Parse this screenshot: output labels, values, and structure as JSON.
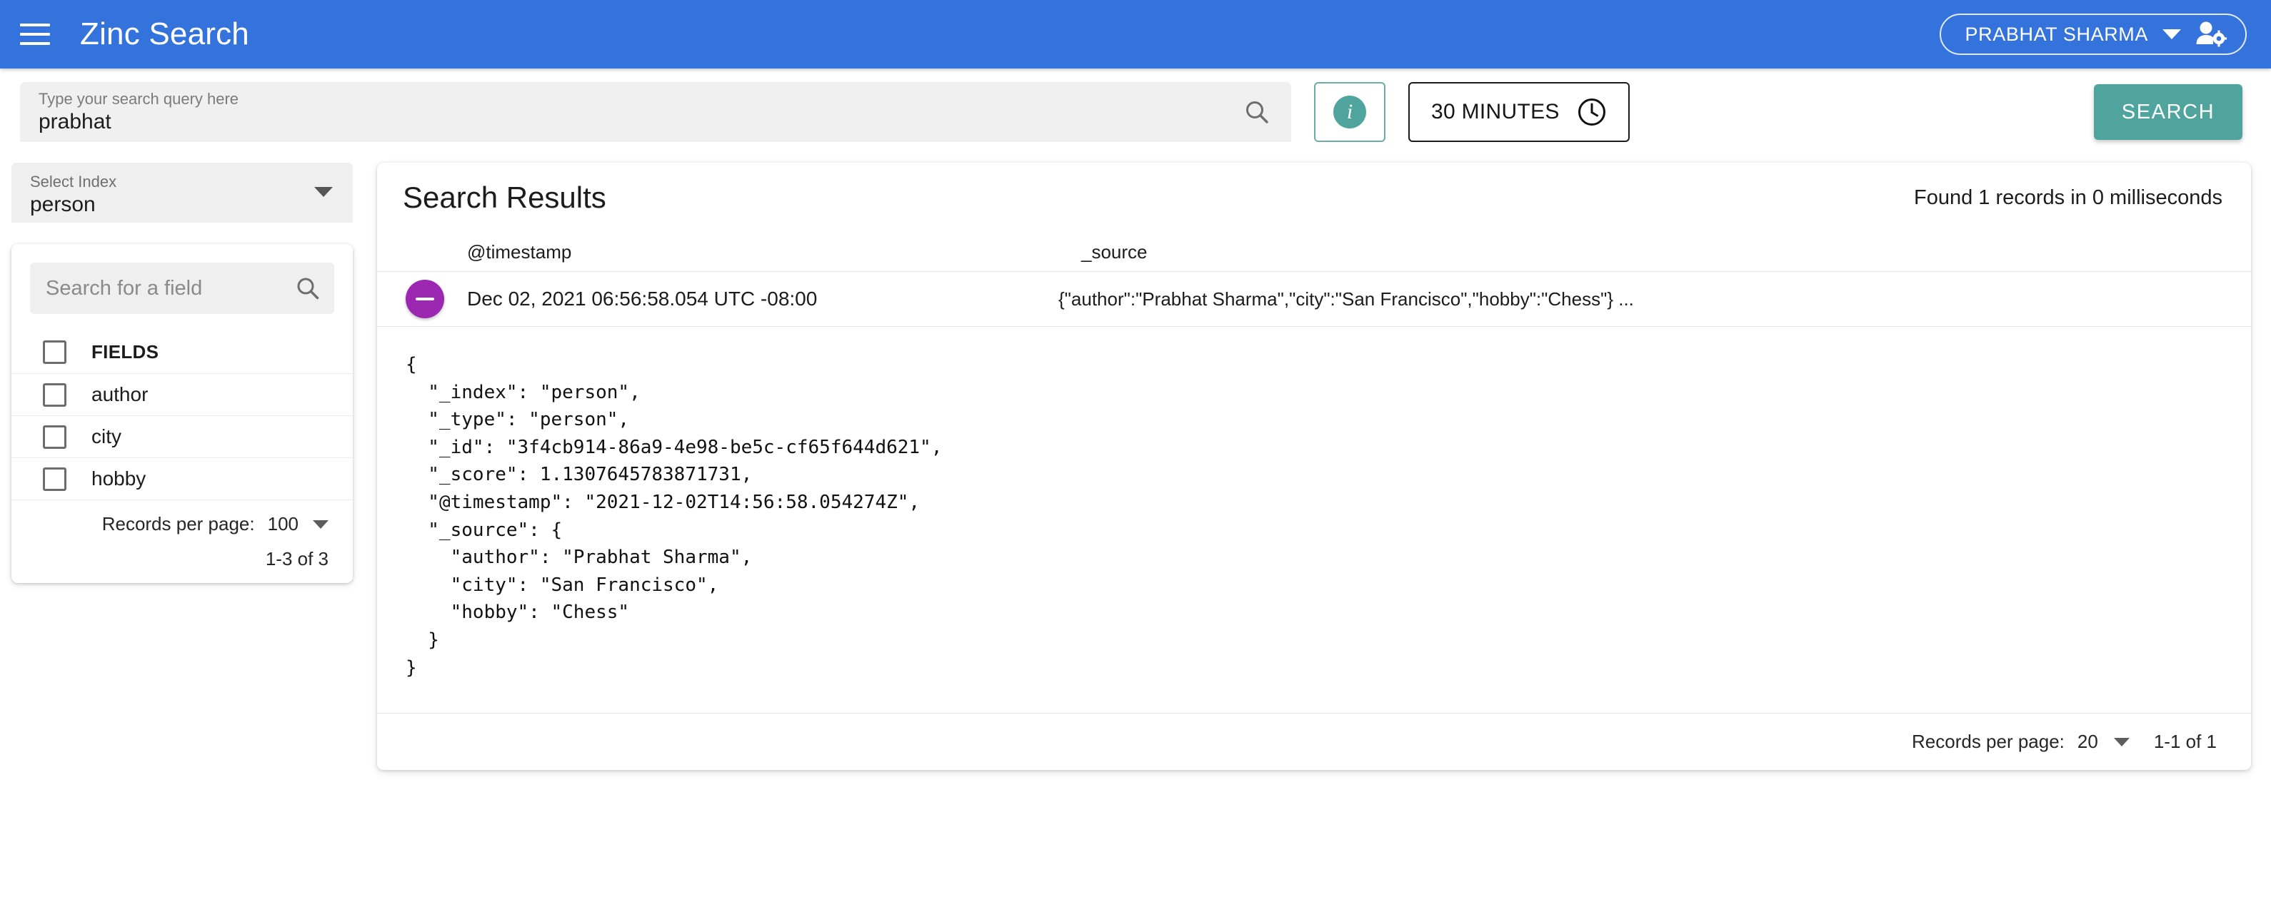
{
  "appbar": {
    "menu_icon": "hamburger-menu-icon",
    "title": "Zinc Search",
    "user": {
      "name": "PRABHAT SHARMA",
      "caret_icon": "chevron-down-icon",
      "avatar_icon": "person-gear-icon"
    },
    "background_color": "#3573dc"
  },
  "querybar": {
    "query_label": "Type your search query here",
    "query_value": "prabhat",
    "query_placeholder": "Type your search query here",
    "search_icon": "search-icon",
    "info_button": {
      "icon": "info-icon",
      "glyph": "i",
      "color": "#4fa59d"
    },
    "time_range": {
      "label": "30 MINUTES",
      "icon": "clock-icon"
    },
    "search_button": {
      "label": "SEARCH",
      "color": "#4fa59d"
    }
  },
  "sidebar": {
    "index_select": {
      "label": "Select Index",
      "value": "person",
      "caret_icon": "chevron-down-icon"
    },
    "field_search": {
      "placeholder": "Search for a field",
      "value": "",
      "icon": "search-icon"
    },
    "fields_header": "FIELDS",
    "fields": [
      {
        "label": "author",
        "checked": false
      },
      {
        "label": "city",
        "checked": false
      },
      {
        "label": "hobby",
        "checked": false
      }
    ],
    "pager": {
      "records_label": "Records per page:",
      "records_value": "100",
      "caret_icon": "chevron-down-icon",
      "range": "1-3 of 3"
    }
  },
  "results": {
    "title": "Search Results",
    "found_text": "Found 1 records in 0 milliseconds",
    "columns": {
      "timestamp": "@timestamp",
      "source": "_source"
    },
    "row": {
      "expand_icon": "minus-circle-icon",
      "expand_color": "#9c27b0",
      "timestamp": "Dec 02, 2021 06:56:58.054 UTC -08:00",
      "source_preview": "{\"author\":\"Prabhat Sharma\",\"city\":\"San Francisco\",\"hobby\":\"Chess\"} ..."
    },
    "document_json": "{\n  \"_index\": \"person\",\n  \"_type\": \"person\",\n  \"_id\": \"3f4cb914-86a9-4e98-be5c-cf65f644d621\",\n  \"_score\": 1.1307645783871731,\n  \"@timestamp\": \"2021-12-02T14:56:58.054274Z\",\n  \"_source\": {\n    \"author\": \"Prabhat Sharma\",\n    \"city\": \"San Francisco\",\n    \"hobby\": \"Chess\"\n  }\n}",
    "document_fields": {
      "_index": "person",
      "_type": "person",
      "_id": "3f4cb914-86a9-4e98-be5c-cf65f644d621",
      "_score": "1.1307645783871731",
      "@timestamp": "2021-12-02T14:56:58.054274Z",
      "_source": {
        "author": "Prabhat Sharma",
        "city": "San Francisco",
        "hobby": "Chess"
      }
    },
    "pager": {
      "records_label": "Records per page:",
      "records_value": "20",
      "caret_icon": "chevron-down-icon",
      "range": "1-1 of 1"
    }
  }
}
